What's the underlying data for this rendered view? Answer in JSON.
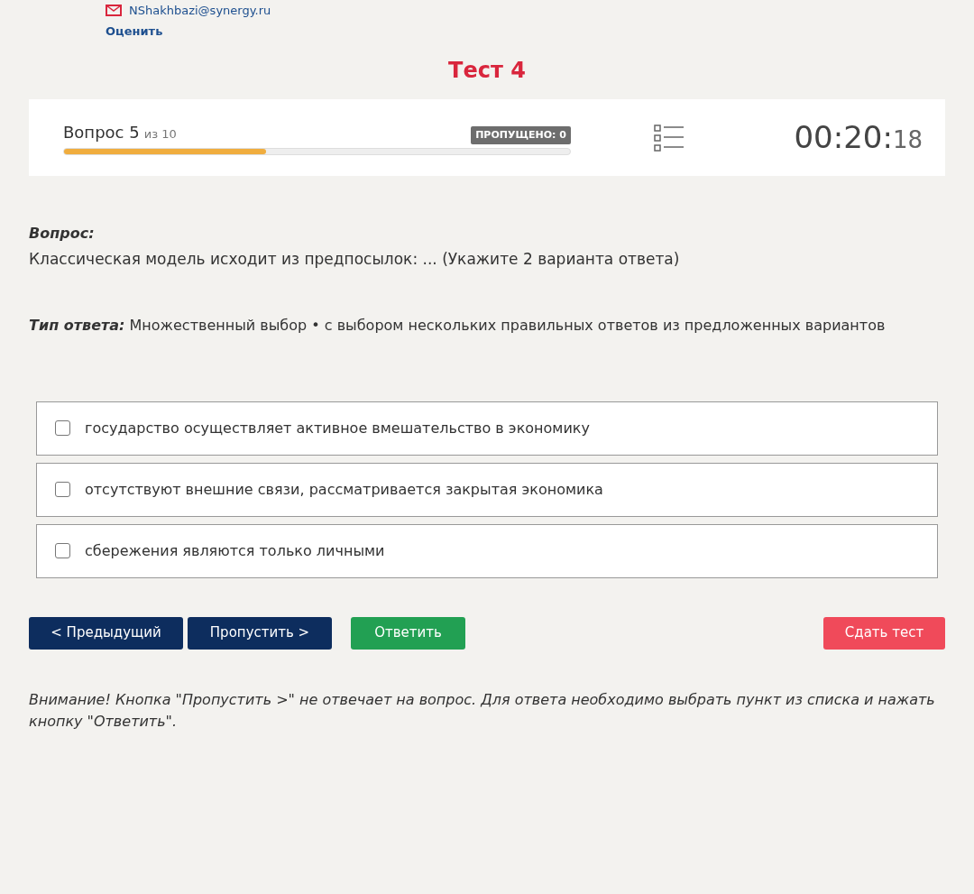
{
  "user": {
    "email": "NShakhbazi@synergy.ru",
    "rate_link": "Оценить"
  },
  "title": "Тест 4",
  "progress": {
    "label": "Вопрос 5",
    "of": "из 10",
    "skipped": "ПРОПУЩЕНО: 0",
    "level": 0.4
  },
  "timer": {
    "main": "00:20:",
    "seconds": "18"
  },
  "question": {
    "label": "Вопрос:",
    "text": "Классическая модель исходит из предпосылок: ... (Укажите 2 варианта ответа)"
  },
  "answer_type": {
    "label": "Тип ответа:",
    "text": "Множественный выбор • с выбором нескольких правильных ответов из предложенных вариантов"
  },
  "options": [
    {
      "text": "государство осуществляет активное вмешательство в экономику",
      "checked": false
    },
    {
      "text": "отсутствуют внешние связи, рассматривается закрытая экономика",
      "checked": false
    },
    {
      "text": "сбережения являются только личными",
      "checked": false
    }
  ],
  "buttons": [
    {
      "label": "< Предыдущий",
      "kind": "nav"
    },
    {
      "label": "Пропустить >",
      "kind": "nav"
    },
    {
      "label": "Ответить",
      "kind": "answer"
    },
    {
      "label": "Сдать тест",
      "kind": "finish"
    }
  ],
  "notice": "Внимание! Кнопка \"Пропустить >\" не отвечает на вопрос. Для ответа необходимо выбрать пункт из списка и нажать кнопку \"Ответить\"."
}
